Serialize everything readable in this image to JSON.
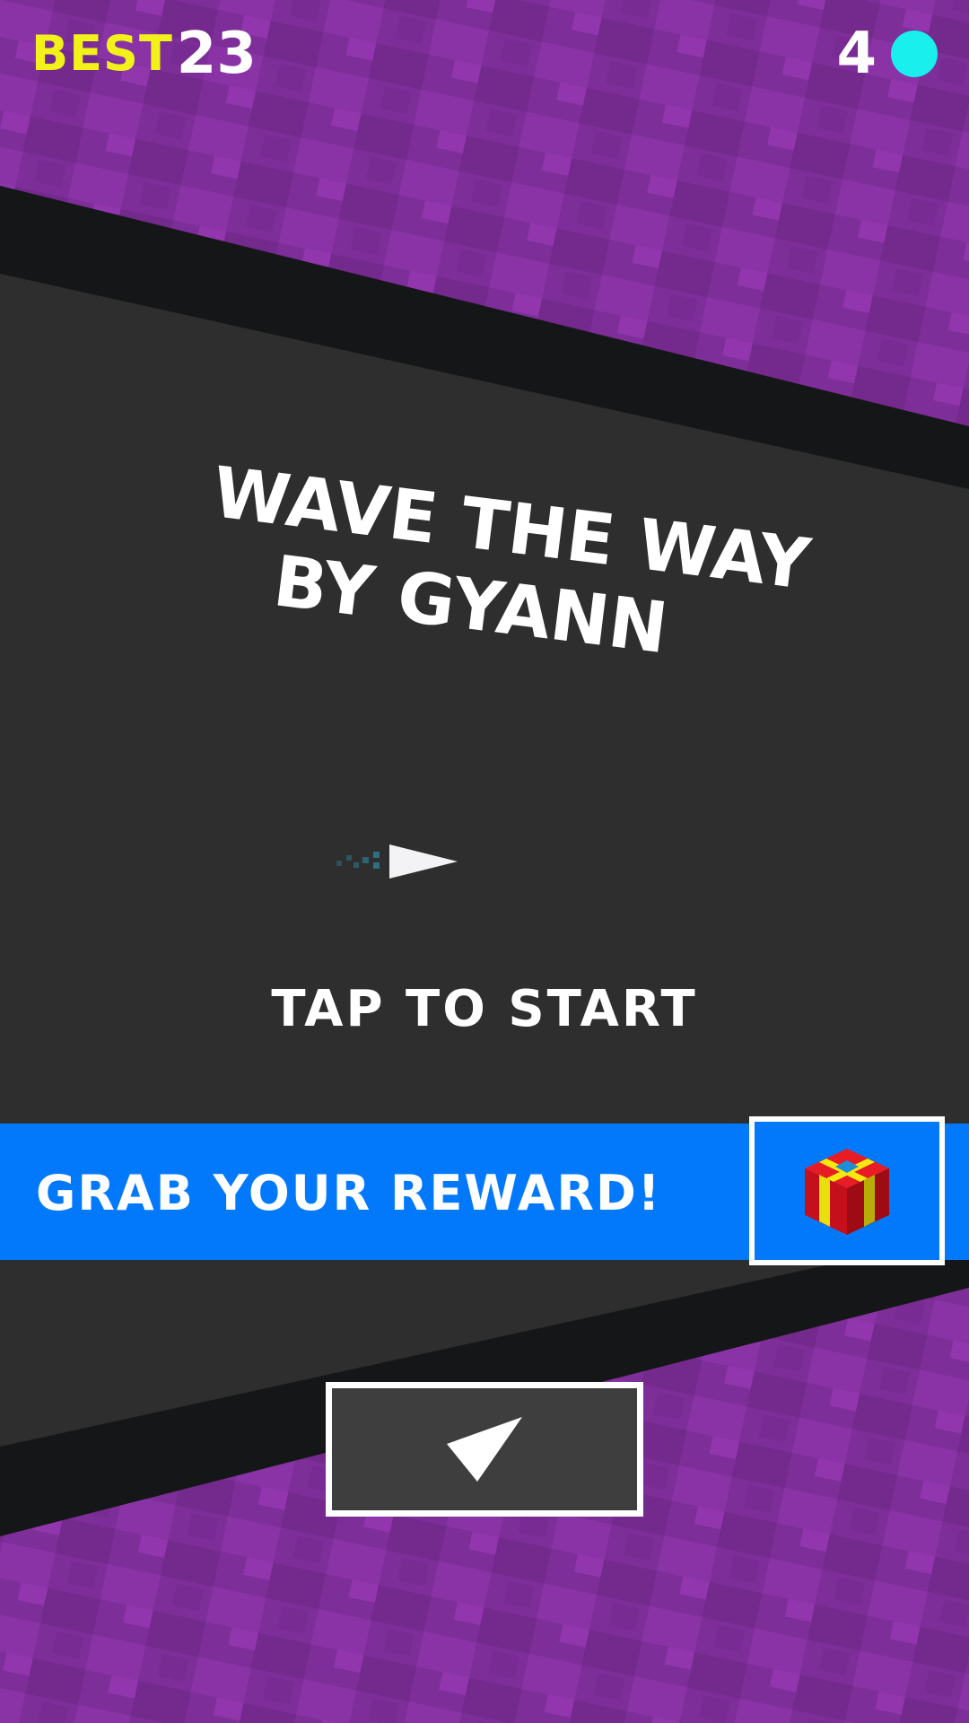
{
  "hud": {
    "best_label": "BEST",
    "best_value": "23",
    "coin_count": "4",
    "coin_icon": "coin-icon"
  },
  "title": {
    "line1": "WAVE THE WAY",
    "line2": "BY GYANN"
  },
  "prompt": "TAP TO START",
  "reward": {
    "label": "GRAB YOUR REWARD!",
    "icon": "gift-icon"
  },
  "play_button": {
    "icon": "play-arrow-icon"
  },
  "colors": {
    "background_purple": "#7d2e99",
    "track_dark": "#2e2e2e",
    "track_border": "#151617",
    "best_yellow": "#f2f21a",
    "coin_cyan": "#19f0ee",
    "reward_blue": "#0279fb"
  }
}
